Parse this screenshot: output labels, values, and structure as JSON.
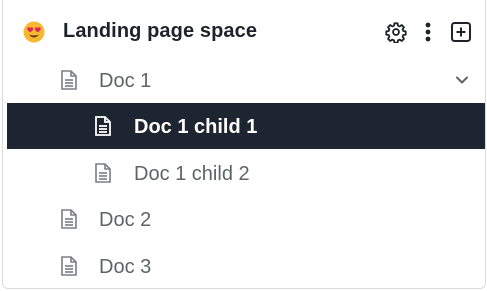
{
  "space": {
    "emoji": "😍",
    "title": "Landing page space",
    "actions": [
      "settings-icon",
      "more-vertical-icon",
      "add-page-icon"
    ]
  },
  "tree": [
    {
      "label": "Doc 1",
      "level": 1,
      "expanded": true,
      "selected": false,
      "icon": "document-icon"
    },
    {
      "label": "Doc 1 child 1",
      "level": 2,
      "selected": true,
      "icon": "document-icon"
    },
    {
      "label": "Doc 1 child 2",
      "level": 2,
      "selected": false,
      "icon": "document-icon"
    },
    {
      "label": "Doc 2",
      "level": 1,
      "selected": false,
      "icon": "document-icon"
    },
    {
      "label": "Doc 3",
      "level": 1,
      "selected": false,
      "icon": "document-icon"
    }
  ],
  "colors": {
    "selected_bg": "#1d2530",
    "text": "#5f6368",
    "title": "#1f2329",
    "icon": "#7a7f85"
  }
}
